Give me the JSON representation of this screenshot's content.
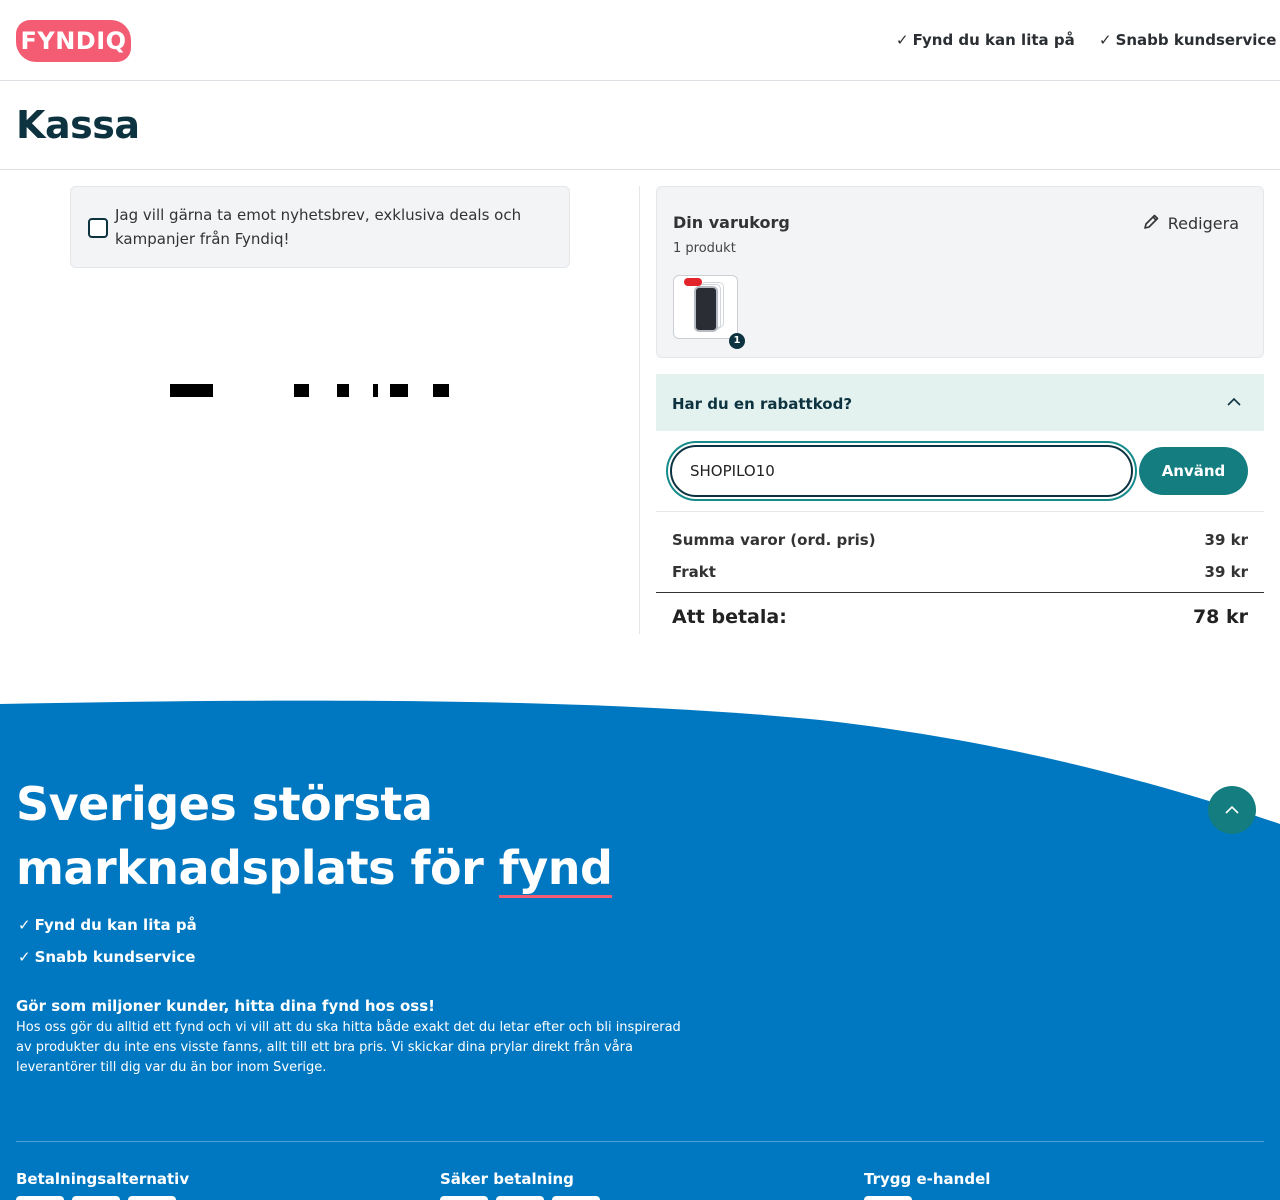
{
  "header": {
    "logo_text": "FYNDIQ",
    "usp_1": "Fynd du kan lita på",
    "usp_2": "Snabb kundservice",
    "check": "✓"
  },
  "page": {
    "title": "Kassa"
  },
  "newsletter": {
    "label": "Jag vill gärna ta emot nyhetsbrev, exklusiva deals och kampanjer från Fyndiq!",
    "checked": false
  },
  "cart": {
    "title": "Din varukorg",
    "count": "1 produkt",
    "edit_label": "Redigera",
    "item_quantity": "1"
  },
  "discount": {
    "title": "Har du en rabattkod?",
    "code_value": "SHOPILO10",
    "apply_label": "Använd"
  },
  "summary": {
    "goods_label": "Summa varor (ord. pris)",
    "goods_value": "39 kr",
    "shipping_label": "Frakt",
    "shipping_value": "39 kr",
    "total_label": "Att betala:",
    "total_value": "78 kr"
  },
  "footer": {
    "hero_line1": "Sveriges största",
    "hero_line2": "marknadsplats för",
    "hero_highlight": "fynd",
    "usp_1": "Fynd du kan lita på",
    "usp_2": "Snabb kundservice",
    "heading": "Gör som miljoner kunder, hitta dina fynd hos oss!",
    "text": "Hos oss gör du alltid ett fynd och vi vill att du ska hitta både exakt det du letar efter och bli inspirerad av produkter du inte ens visste fanns, allt till ett bra pris. Vi skickar dina prylar direkt från våra leverantörer till dig var du än bor inom Sverige.",
    "col_1": "Betalningsalternativ",
    "col_2": "Säker betalning",
    "col_3": "Trygg e-handel"
  },
  "colors": {
    "brand_pink": "#f45c73",
    "dark_teal": "#0d3340",
    "button_teal": "#137d80",
    "footer_blue": "#0078c1",
    "discount_bg": "#e3f2ef"
  },
  "icons": [
    "check-icon",
    "pencil-icon",
    "chevron-up-icon",
    "arrow-up-icon"
  ]
}
